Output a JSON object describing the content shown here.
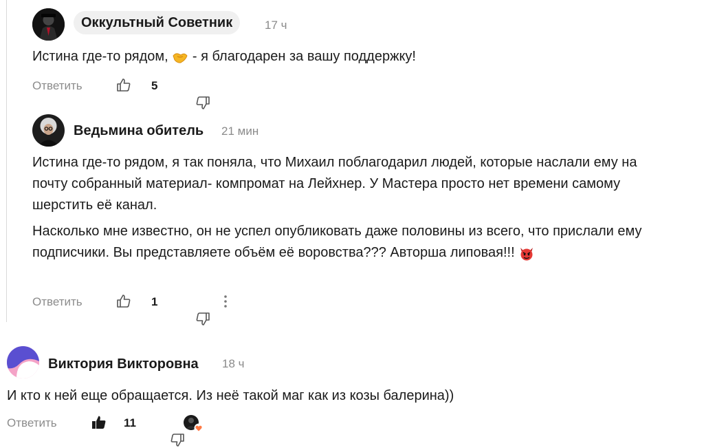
{
  "comments": [
    {
      "author": "Оккультный Советник",
      "time": "17 ч",
      "text_before": "Истина где-то рядом,",
      "text_after": " - я благодарен за вашу поддержку!",
      "reply_label": "Ответить",
      "likes": "5"
    },
    {
      "author": "Ведьмина обитель",
      "time": "21 мин",
      "paragraph_1": "Истина где-то рядом, я так поняла, что Михаил поблагодарил людей, которые наслали ему на почту собранный материал- компромат на Лейхнер. У Мастера просто нет времени самому шерстить её канал.",
      "paragraph_2": "Насколько мне известно, он не успел опубликовать даже половины из всего, что прислали ему подписчики. Вы представляете объём её воровства??? Авторша липовая!!!",
      "reply_label": "Ответить",
      "likes": "1"
    },
    {
      "author": "Виктория Викторовна",
      "time": "18 ч",
      "text": "И кто к ней еще обращается. Из неё такой маг как из козы балерина))",
      "reply_label": "Ответить",
      "likes": "11"
    }
  ],
  "colors": {
    "accent_pink": "#f4a3c7",
    "accent_purple": "#5a4fd1",
    "heart_orange": "#ff7a45"
  }
}
